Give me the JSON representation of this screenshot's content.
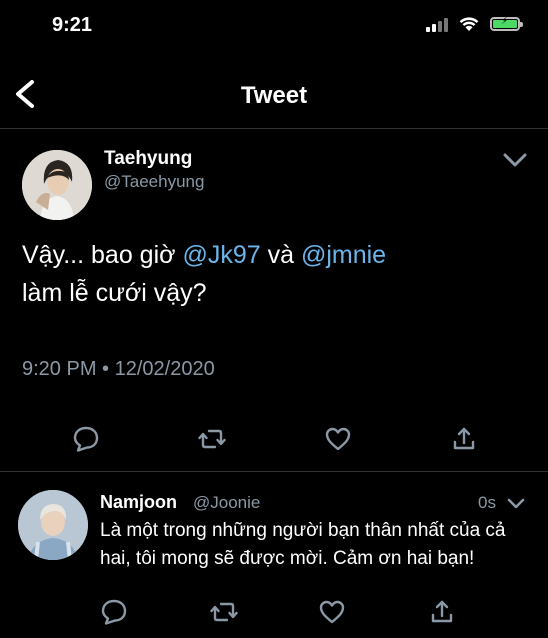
{
  "status": {
    "time": "9:21"
  },
  "nav": {
    "title": "Tweet"
  },
  "tweet": {
    "author_name": "Taehyung",
    "author_handle": "@Taeehyung",
    "text_part1": "Vậy... bao giờ ",
    "mention1": "@Jk97",
    "text_part2": " và ",
    "mention2": "@jmnie",
    "text_part3": "làm lễ cưới vậy?",
    "timestamp": "9:20 PM • 12/02/2020"
  },
  "reply": {
    "author_name": "Namjoon",
    "author_handle": "@Joonie",
    "time": "0s",
    "text": "Là một trong những người bạn thân nhất của cả hai, tôi mong sẽ được mời. Cảm ơn hai bạn!"
  },
  "icons": {
    "back": "chevron-left-icon",
    "more": "chevron-down-icon",
    "reply": "comment-icon",
    "retweet": "retweet-icon",
    "like": "heart-icon",
    "share": "share-icon"
  },
  "colors": {
    "background": "#000000",
    "mention": "#6cb4ea",
    "secondary_text": "#8b98a5",
    "divider": "#2f3336",
    "battery": "#4cd964"
  }
}
